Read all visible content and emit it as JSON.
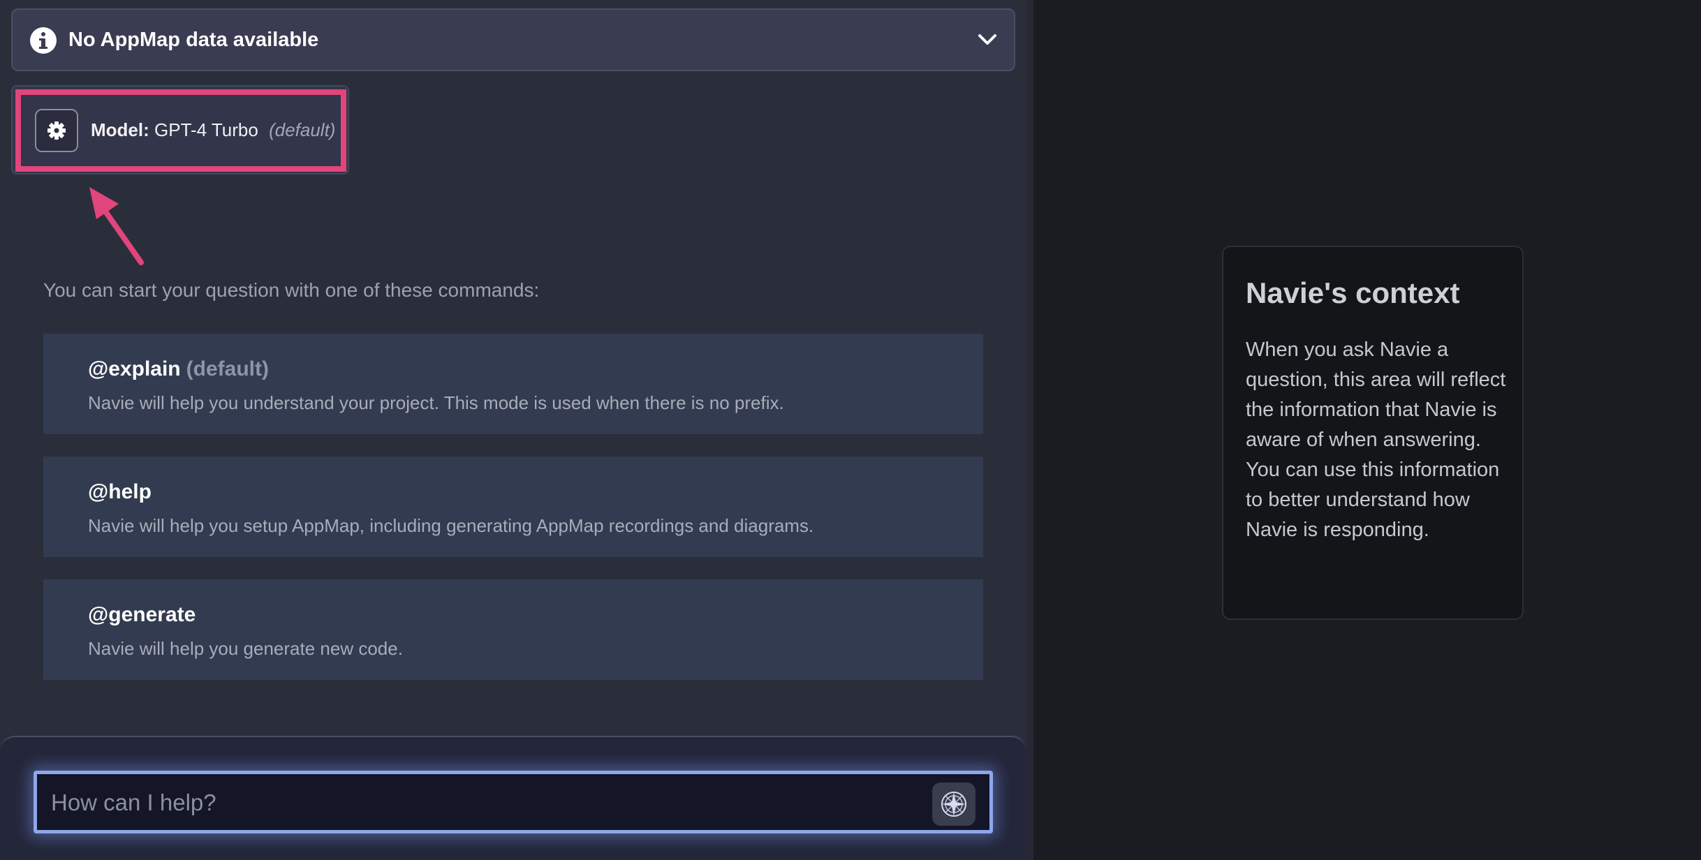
{
  "banner": {
    "title": "No AppMap data available",
    "info_icon": "info-icon",
    "chevron_icon": "chevron-down-icon"
  },
  "model": {
    "label": "Model:",
    "value": "GPT-4 Turbo",
    "default_tag": "(default)",
    "gear_icon": "gear-icon"
  },
  "annotation": {
    "color": "#e0457b"
  },
  "commands": {
    "intro": "You can start your question with one of these commands:",
    "items": [
      {
        "name": "@explain",
        "tag": "(default)",
        "description": "Navie will help you understand your project. This mode is used when there is no prefix."
      },
      {
        "name": "@help",
        "tag": "",
        "description": "Navie will help you setup AppMap, including generating AppMap recordings and diagrams."
      },
      {
        "name": "@generate",
        "tag": "",
        "description": "Navie will help you generate new code."
      }
    ]
  },
  "input": {
    "placeholder": "How can I help?",
    "send_icon": "compass-icon"
  },
  "context": {
    "title": "Navie's context",
    "body": "When you ask Navie a question, this area will reflect the information that Navie is aware of when answering. You can use this information to better understand how Navie is responding."
  },
  "colors": {
    "accent_highlight": "#e0457b",
    "input_glow": "#8fa6ec",
    "panel_bg": "#2a2d3a",
    "card_bg": "#323b4f"
  }
}
